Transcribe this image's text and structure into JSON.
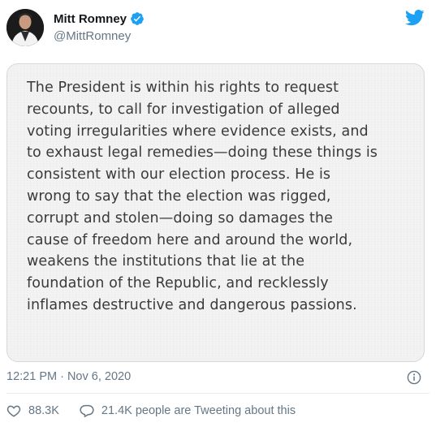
{
  "author": {
    "name": "Mitt Romney",
    "handle": "@MittRomney",
    "verified": true,
    "avatar_icon": "profile-photo"
  },
  "brand": {
    "icon": "twitter-bird-icon",
    "color": "#1da1f2"
  },
  "statement": {
    "lines": [
      "The President is within his rights to request",
      "recounts, to call for investigation of alleged",
      "voting irregularities where evidence exists, and",
      "to exhaust legal remedies—doing these things is",
      "consistent with our election process. He is",
      "wrong to say that the election was rigged,",
      "corrupt and stolen—doing so damages the",
      "cause of freedom here and around the world,",
      "weakens the institutions that lie at the",
      "foundation of the Republic, and recklessly",
      "inflames destructive and dangerous passions."
    ]
  },
  "meta": {
    "timestamp": "12:21 PM · Nov 6, 2020",
    "info_icon": "info-icon"
  },
  "actions": {
    "likes": "88.3K",
    "tweeting": "21.4K people are Tweeting about this",
    "like_icon": "heart-icon",
    "reply_icon": "speech-bubble-icon"
  },
  "colors": {
    "text_primary": "#14171a",
    "text_secondary": "#657786",
    "verified_badge": "#1da1f2"
  }
}
